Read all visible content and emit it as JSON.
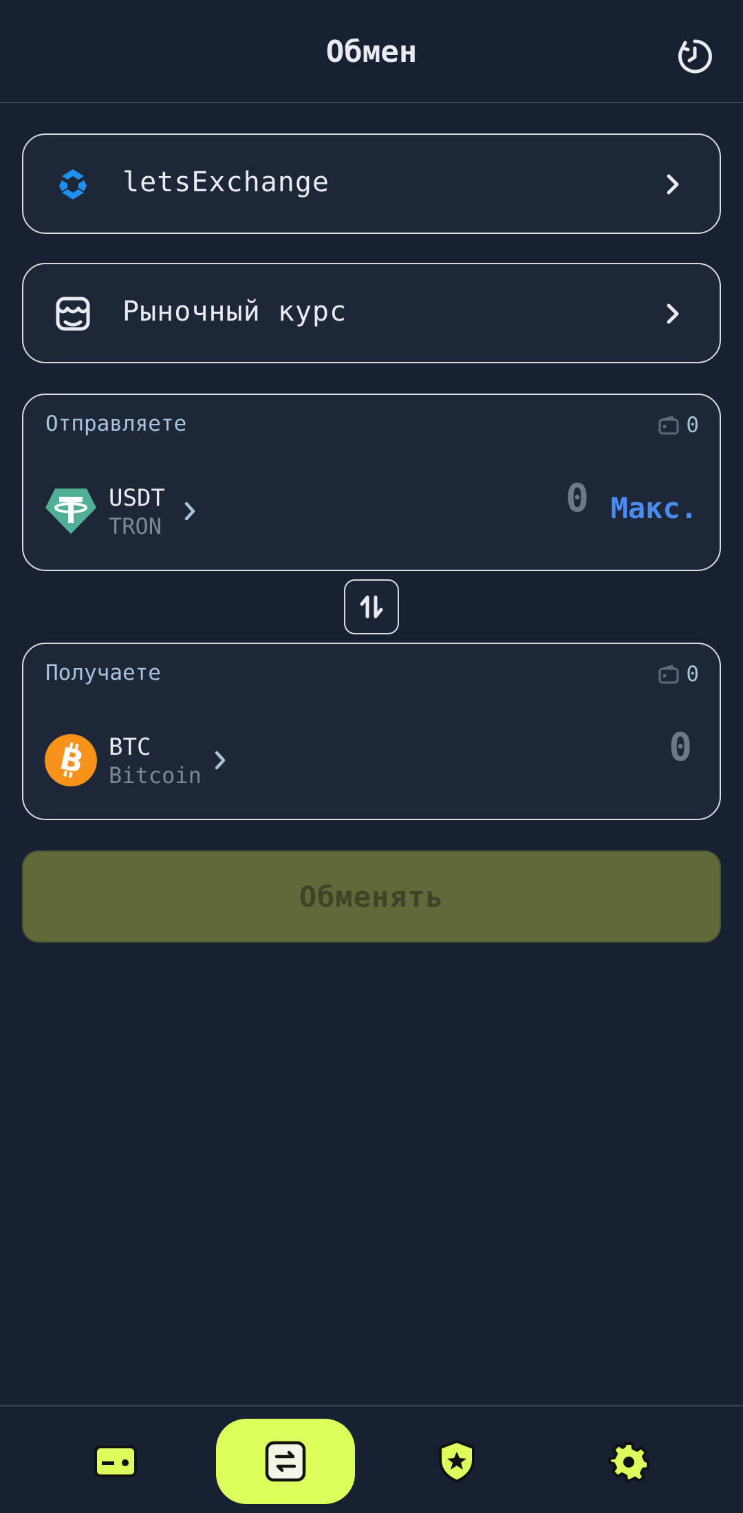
{
  "header": {
    "title": "Обмен",
    "history_icon": "history-icon"
  },
  "provider": {
    "label": "letsExchange",
    "icon": "letsexchange-logo-icon"
  },
  "rate_type": {
    "label": "Рыночный курс",
    "icon": "market-icon"
  },
  "send": {
    "label": "Отправляете",
    "balance": "0",
    "asset_symbol": "USDT",
    "asset_network": "TRON",
    "amount": "0",
    "max_label": "Макс."
  },
  "receive": {
    "label": "Получаете",
    "balance": "0",
    "asset_symbol": "BTC",
    "asset_network": "Bitcoin",
    "amount": "0"
  },
  "exchange_button": {
    "label": "Обменять"
  },
  "bottom_nav": {
    "items": [
      {
        "name": "wallet",
        "icon": "wallet-icon",
        "active": false
      },
      {
        "name": "exchange",
        "icon": "exchange-icon",
        "active": true
      },
      {
        "name": "security",
        "icon": "shield-star-icon",
        "active": false
      },
      {
        "name": "settings",
        "icon": "gear-icon",
        "active": false
      }
    ]
  },
  "colors": {
    "background": "#172132",
    "card": "#1e2738",
    "accent": "#dcff5c",
    "max_link": "#4a8df0",
    "usdt": "#50af95",
    "btc": "#f7931a"
  }
}
